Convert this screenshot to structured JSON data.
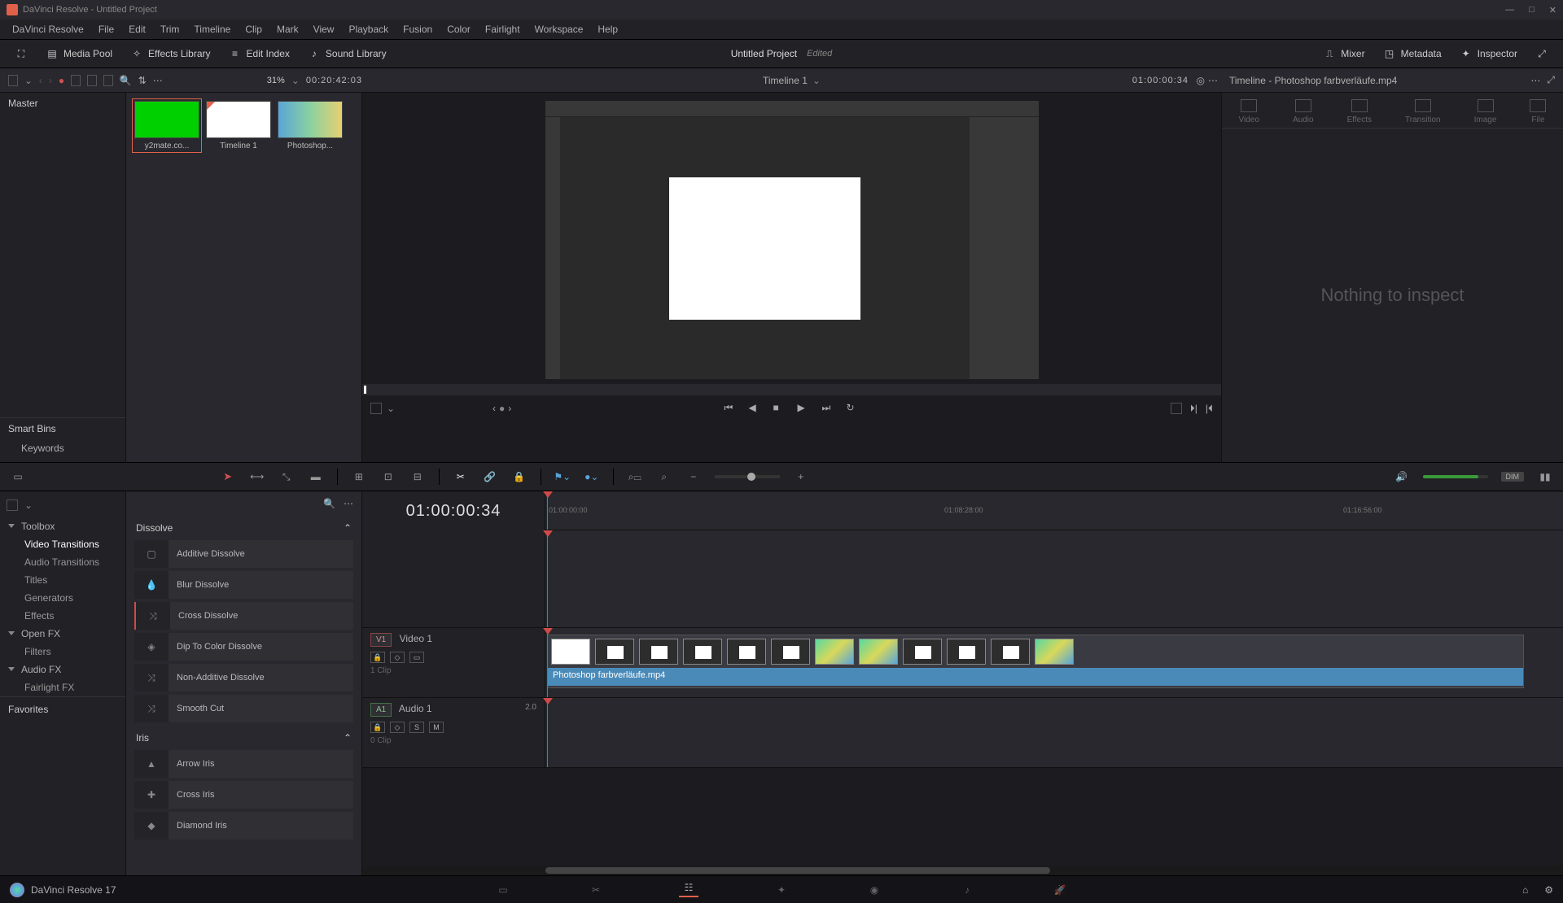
{
  "app": {
    "title": "DaVinci Resolve - Untitled Project",
    "product": "DaVinci Resolve 17"
  },
  "menu": {
    "items": [
      "DaVinci Resolve",
      "File",
      "Edit",
      "Trim",
      "Timeline",
      "Clip",
      "Mark",
      "View",
      "Playback",
      "Fusion",
      "Color",
      "Fairlight",
      "Workspace",
      "Help"
    ]
  },
  "top": {
    "media_pool": "Media Pool",
    "effects_library": "Effects Library",
    "edit_index": "Edit Index",
    "sound_library": "Sound Library",
    "project": "Untitled Project",
    "edited": "Edited",
    "mixer": "Mixer",
    "metadata": "Metadata",
    "inspector": "Inspector"
  },
  "subheader": {
    "zoom": "31%",
    "tc_left": "00:20:42:03",
    "timeline_name": "Timeline 1",
    "tc_right": "01:00:00:34",
    "inspector_title": "Timeline - Photoshop farbverläufe.mp4"
  },
  "media_pool": {
    "master": "Master",
    "smart_bins": "Smart Bins",
    "keywords": "Keywords",
    "clips": [
      {
        "label": "y2mate.co..."
      },
      {
        "label": "Timeline 1"
      },
      {
        "label": "Photoshop..."
      }
    ]
  },
  "inspector": {
    "tabs": [
      "Video",
      "Audio",
      "Effects",
      "Transition",
      "Image",
      "File"
    ],
    "empty": "Nothing to inspect"
  },
  "effects_tree": {
    "toolbox": "Toolbox",
    "video_transitions": "Video Transitions",
    "audio_transitions": "Audio Transitions",
    "titles": "Titles",
    "generators": "Generators",
    "effects": "Effects",
    "openfx": "Open FX",
    "filters": "Filters",
    "audiofx": "Audio FX",
    "fairlightfx": "Fairlight FX",
    "favorites": "Favorites"
  },
  "effects_list": {
    "group_dissolve": "Dissolve",
    "items_dissolve": [
      "Additive Dissolve",
      "Blur Dissolve",
      "Cross Dissolve",
      "Dip To Color Dissolve",
      "Non-Additive Dissolve",
      "Smooth Cut"
    ],
    "group_iris": "Iris",
    "items_iris": [
      "Arrow Iris",
      "Cross Iris",
      "Diamond Iris"
    ]
  },
  "timeline": {
    "tc": "01:00:00:34",
    "ruler_ticks": [
      "01:00:00:00",
      "01:08:28:00",
      "01:16:56:00"
    ],
    "video_track": {
      "badge": "V1",
      "name": "Video 1",
      "subtitle": "1 Clip"
    },
    "audio_track": {
      "badge": "A1",
      "name": "Audio 1",
      "level": "2.0",
      "subtitle": "0 Clip"
    },
    "clip_name": "Photoshop farbverläufe.mp4",
    "solo": "S",
    "mute": "M"
  },
  "audio": {
    "dim": "DIM"
  }
}
